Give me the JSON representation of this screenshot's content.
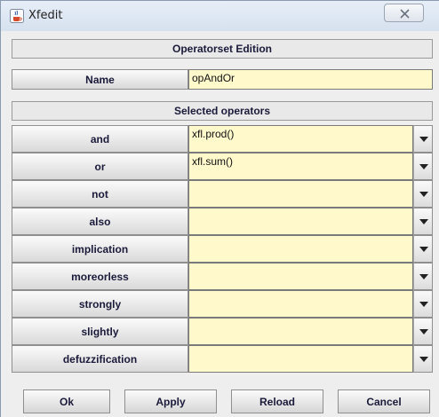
{
  "window": {
    "title": "Xfedit"
  },
  "operatorset_header": "Operatorset Edition",
  "name": {
    "label": "Name",
    "value": "opAndOr"
  },
  "selected_header": "Selected operators",
  "operators": [
    {
      "label": "and",
      "value": "xfl.prod()"
    },
    {
      "label": "or",
      "value": "xfl.sum()"
    },
    {
      "label": "not",
      "value": ""
    },
    {
      "label": "also",
      "value": ""
    },
    {
      "label": "implication",
      "value": ""
    },
    {
      "label": "moreorless",
      "value": ""
    },
    {
      "label": "strongly",
      "value": ""
    },
    {
      "label": "slightly",
      "value": ""
    },
    {
      "label": "defuzzification",
      "value": ""
    }
  ],
  "buttons": {
    "ok": "Ok",
    "apply": "Apply",
    "reload": "Reload",
    "cancel": "Cancel"
  },
  "icons": {
    "app": "java-cup-icon",
    "close": "close-icon",
    "dropdown": "chevron-down-icon"
  },
  "colors": {
    "field_background": "#fff9cc",
    "window_background": "#eeeeee"
  }
}
